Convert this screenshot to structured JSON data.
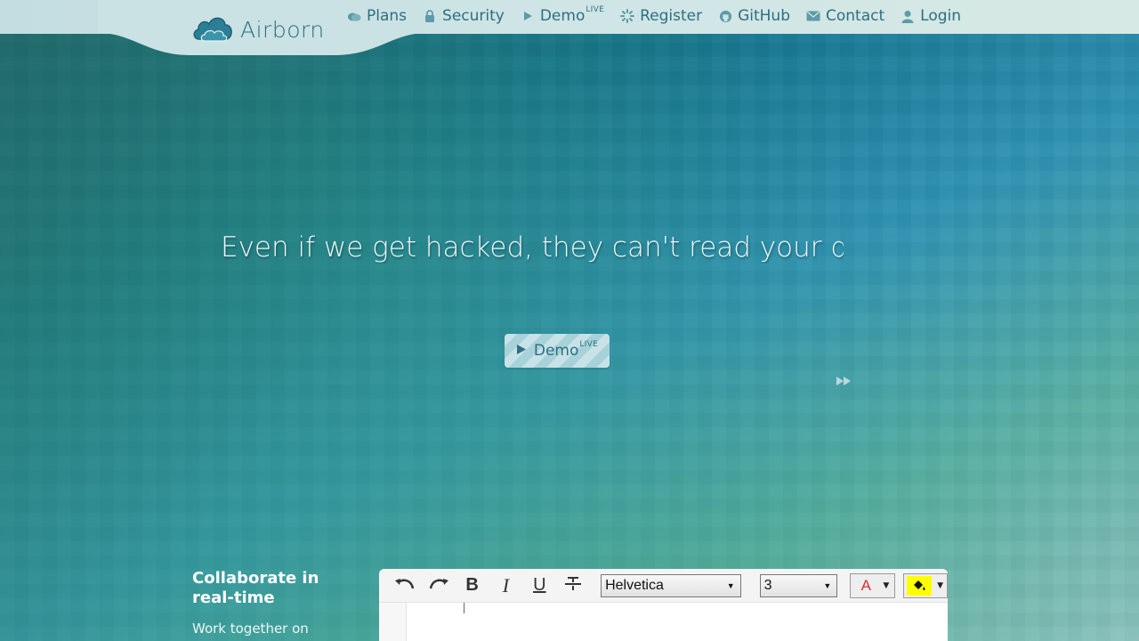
{
  "brand": {
    "name": "Airborn"
  },
  "nav": [
    {
      "label": "Plans",
      "icon": "cloud-icon"
    },
    {
      "label": "Security",
      "icon": "lock-icon"
    },
    {
      "label": "Demo",
      "sup": "LIVE",
      "icon": "play-icon"
    },
    {
      "label": "Register",
      "icon": "sparkle-icon"
    },
    {
      "label": "GitHub",
      "icon": "github-icon"
    },
    {
      "label": "Contact",
      "icon": "envelope-icon"
    },
    {
      "label": "Login",
      "icon": "user-icon"
    }
  ],
  "hero": {
    "tagline": "Even if we get hacked, they can't read your docu",
    "demo_label": "Demo",
    "demo_sup": "LIVE"
  },
  "collab": {
    "title": "Collaborate in real-time",
    "description": "Work together on"
  },
  "editor": {
    "font": "Helvetica",
    "size": "3",
    "text_color_label": "A"
  },
  "colors": {
    "accent": "#2e6f80",
    "header_bg": "#cfe5e6",
    "text_color_swatch": "#e03030",
    "highlight_swatch": "#ffff00"
  }
}
